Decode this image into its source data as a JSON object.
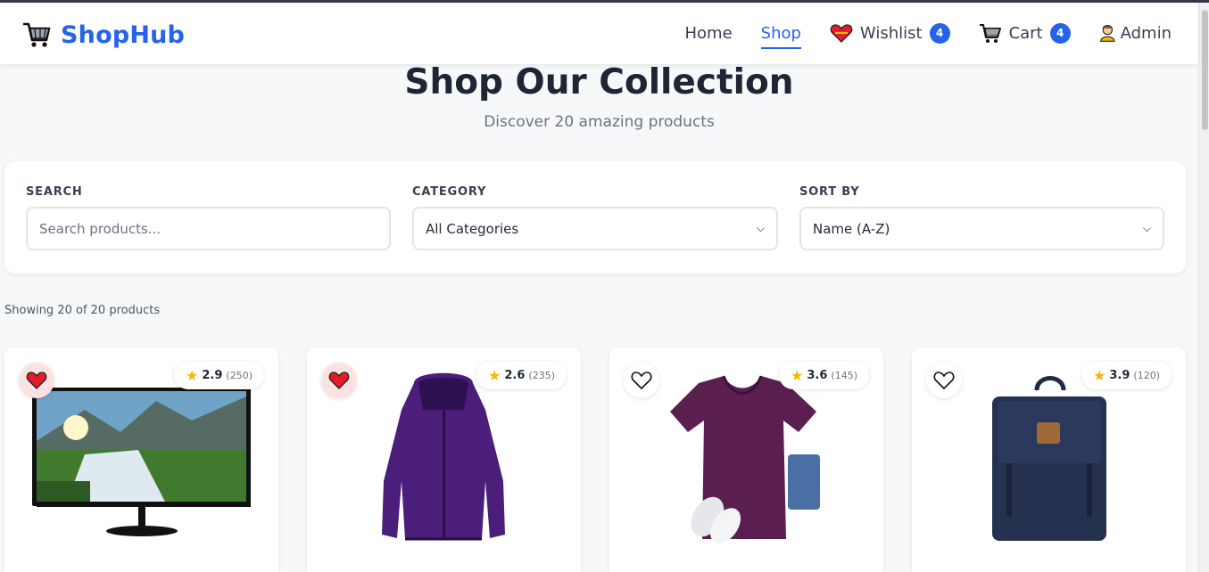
{
  "brand": {
    "name": "ShopHub",
    "icon": "shopping-cart-icon"
  },
  "nav": {
    "home": "Home",
    "shop": "Shop",
    "wishlist": "Wishlist",
    "wishlist_count": "4",
    "cart": "Cart",
    "cart_count": "4",
    "admin": "Admin",
    "active": "Shop"
  },
  "hero": {
    "title": "Shop Our Collection",
    "subtitle": "Discover 20 amazing products"
  },
  "filters": {
    "search_label": "SEARCH",
    "search_placeholder": "Search products...",
    "category_label": "CATEGORY",
    "category_value": "All Categories",
    "sort_label": "SORT BY",
    "sort_value": "Name (A-Z)"
  },
  "results": {
    "showing": "Showing 20 of 20 products"
  },
  "products": [
    {
      "favorited": true,
      "rating": "2.9",
      "reviews": "(250)",
      "image": "monitor-image"
    },
    {
      "favorited": true,
      "rating": "2.6",
      "reviews": "(235)",
      "image": "purple-jacket-image"
    },
    {
      "favorited": false,
      "rating": "3.6",
      "reviews": "(145)",
      "image": "be-kind-tshirt-image"
    },
    {
      "favorited": false,
      "rating": "3.9",
      "reviews": "(120)",
      "image": "navy-backpack-image"
    }
  ],
  "colors": {
    "accent": "#2563eb",
    "heart": "#e11d2a",
    "star": "#f5b50a"
  }
}
